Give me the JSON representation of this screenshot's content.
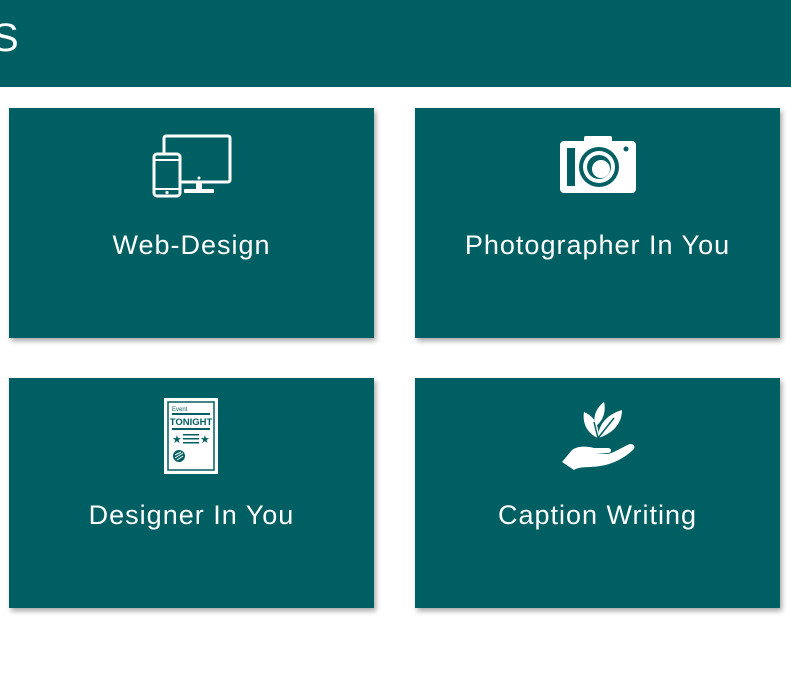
{
  "header": {
    "title": "S"
  },
  "colors": {
    "accent": "#005f62",
    "text": "#ffffff"
  },
  "cards": [
    {
      "label": "Web-Design",
      "icon": "devices-icon"
    },
    {
      "label": "Photographer In You",
      "icon": "camera-icon"
    },
    {
      "label": "Designer In You",
      "icon": "poster-icon"
    },
    {
      "label": "Caption Writing",
      "icon": "hand-plant-icon"
    }
  ],
  "poster": {
    "small_text": "Event",
    "headline": "TONIGHT"
  }
}
